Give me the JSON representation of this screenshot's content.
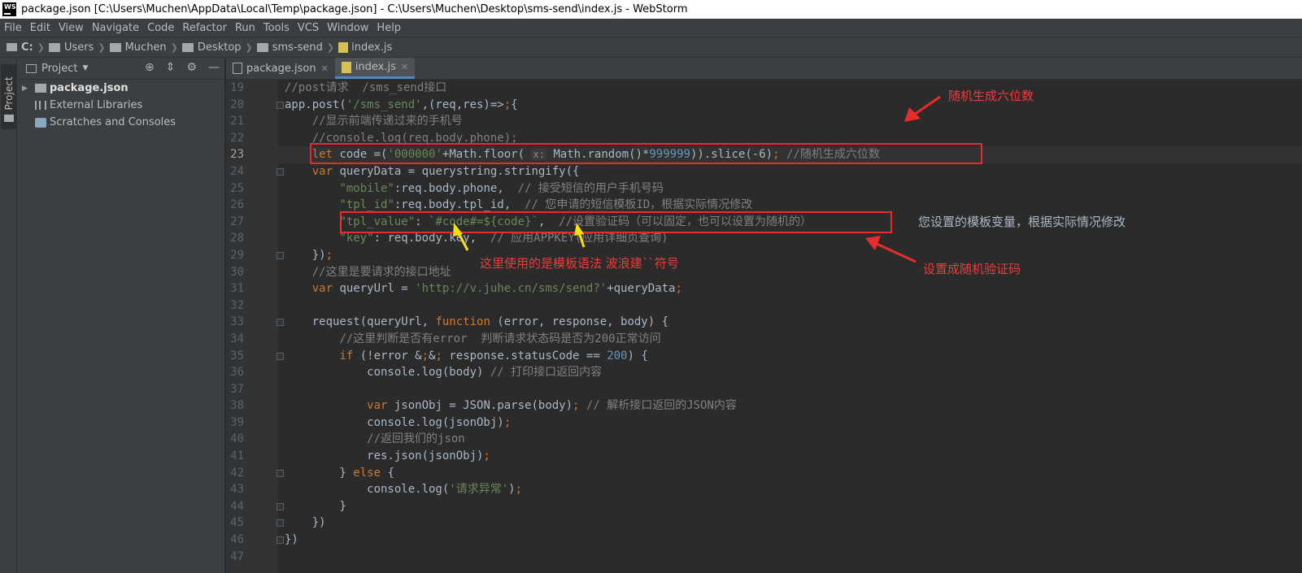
{
  "window": {
    "title": "package.json [C:\\Users\\Muchen\\AppData\\Local\\Temp\\package.json] - C:\\Users\\Muchen\\Desktop\\sms-send\\index.js - WebStorm"
  },
  "menu": [
    "File",
    "Edit",
    "View",
    "Navigate",
    "Code",
    "Refactor",
    "Run",
    "Tools",
    "VCS",
    "Window",
    "Help"
  ],
  "breadcrumb": [
    "C:",
    "Users",
    "Muchen",
    "Desktop",
    "sms-send",
    "index.js"
  ],
  "tool_window_tab": "1: Project",
  "project": {
    "title": "Project",
    "items": [
      "package.json",
      "External Libraries",
      "Scratches and Consoles"
    ]
  },
  "tabs": [
    {
      "label": "package.json"
    },
    {
      "label": "index.js"
    }
  ],
  "code_lines": [
    {
      "n": "19",
      "text": "//post请求  /sms_send接口"
    },
    {
      "n": "20",
      "text": "app.post('/sms_send',(req,res)=>{"
    },
    {
      "n": "21",
      "text": "    //显示前端传递过来的手机号"
    },
    {
      "n": "22",
      "text": "    //console.log(req.body.phone);"
    },
    {
      "n": "23",
      "text": "    let code =('000000'+Math.floor( x: Math.random()*999999)).slice(-6); //随机生成六位数"
    },
    {
      "n": "24",
      "text": "    var queryData = querystring.stringify({"
    },
    {
      "n": "25",
      "text": "        \"mobile\":req.body.phone,  // 接受短信的用户手机号码"
    },
    {
      "n": "26",
      "text": "        \"tpl_id\":req.body.tpl_id,  // 您申请的短信模板ID，根据实际情况修改"
    },
    {
      "n": "27",
      "text": "        \"tpl_value\": `#code#=${code}`,  //设置验证码（可以固定，也可以设置为随机的）"
    },
    {
      "n": "28",
      "text": "        \"key\": req.body.key,  // 应用APPKEY(应用详细页查询)"
    },
    {
      "n": "29",
      "text": "    });"
    },
    {
      "n": "30",
      "text": "    //这里是要请求的接口地址"
    },
    {
      "n": "31",
      "text": "    var queryUrl = 'http://v.juhe.cn/sms/send?'+queryData;"
    },
    {
      "n": "32",
      "text": ""
    },
    {
      "n": "33",
      "text": "    request(queryUrl, function (error, response, body) {"
    },
    {
      "n": "34",
      "text": "        //这里判断是否有error  判断请求状态码是否为200正常访问"
    },
    {
      "n": "35",
      "text": "        if (!error && response.statusCode == 200) {"
    },
    {
      "n": "36",
      "text": "            console.log(body) // 打印接口返回内容"
    },
    {
      "n": "37",
      "text": ""
    },
    {
      "n": "38",
      "text": "            var jsonObj = JSON.parse(body); // 解析接口返回的JSON内容"
    },
    {
      "n": "39",
      "text": "            console.log(jsonObj);"
    },
    {
      "n": "40",
      "text": "            //返回我们的json"
    },
    {
      "n": "41",
      "text": "            res.json(jsonObj);"
    },
    {
      "n": "42",
      "text": "        } else {"
    },
    {
      "n": "43",
      "text": "            console.log('请求异常');"
    },
    {
      "n": "44",
      "text": "        }"
    },
    {
      "n": "45",
      "text": "    })"
    },
    {
      "n": "46",
      "text": "})"
    },
    {
      "n": "47",
      "text": ""
    }
  ],
  "annotations": {
    "random_six": "随机生成六位数",
    "template_var": "您设置的模板变量，根据实际情况修改",
    "template_syntax": "这里使用的是模板语法 波浪建``符号",
    "set_random_code": "设置成随机验证码"
  },
  "colors": {
    "annotation_red": "#e82b2b",
    "arrow_yellow": "#f5e010",
    "keyword": "#cc7832",
    "string": "#6a8759",
    "number": "#6897bb",
    "comment": "#808080"
  }
}
